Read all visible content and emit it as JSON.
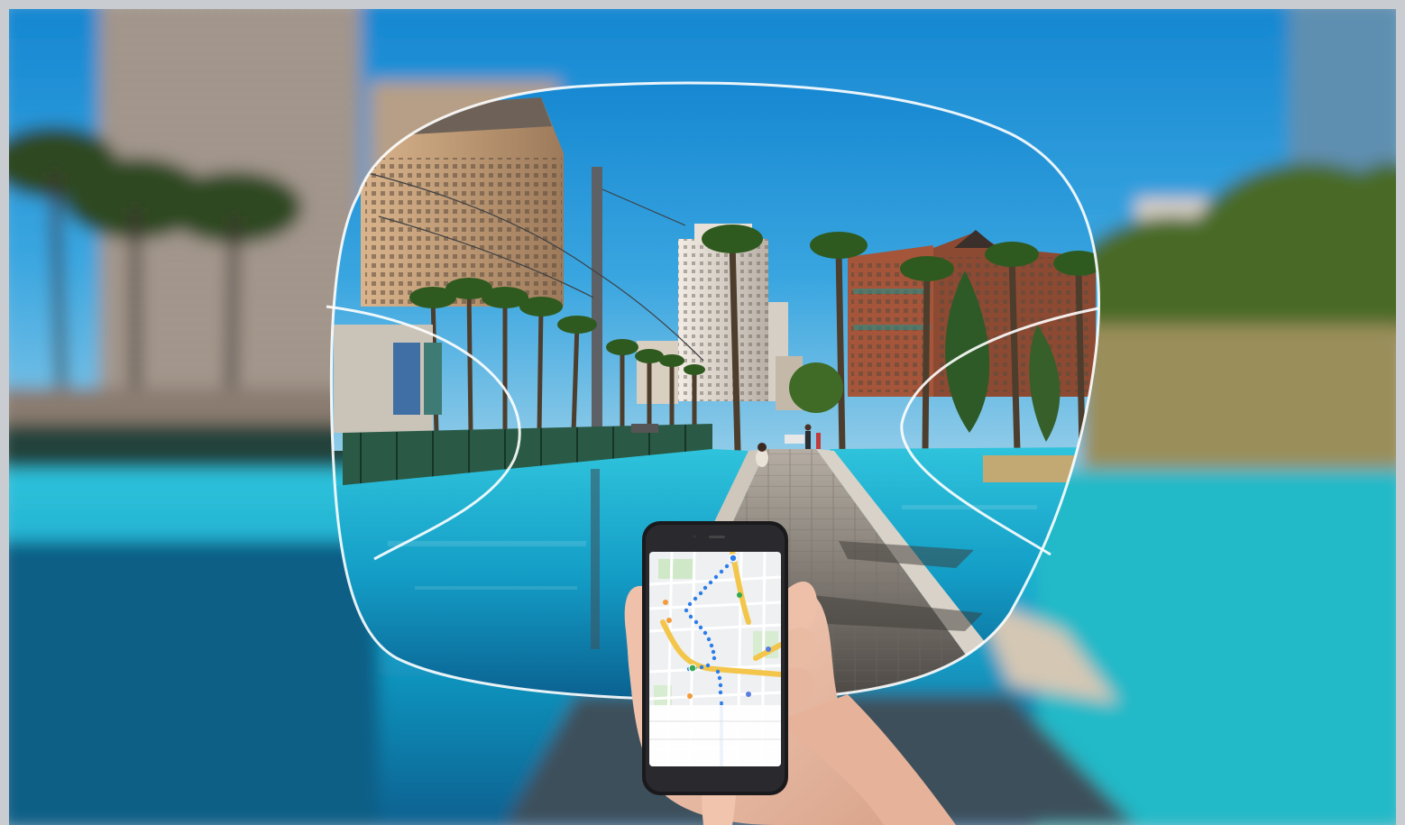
{
  "scene": {
    "subject": "progressive-lens-city-view",
    "elements": [
      "frame-border",
      "blurred-city-background",
      "sharp-lens-view",
      "lens-outline",
      "progressive-zone-lines",
      "hand",
      "smartphone",
      "map-screen"
    ],
    "colors": {
      "sky": "#1f8fd6",
      "water": "#1fb3cf",
      "walkway": "#8a8580",
      "lens_outline": "#ffffff",
      "phone_body": "#1a1a1c",
      "map_route": "#2b7de9",
      "map_road_major": "#f3c64b"
    }
  }
}
